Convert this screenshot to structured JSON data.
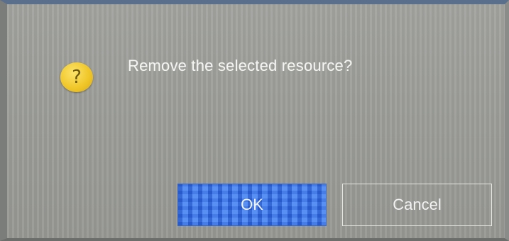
{
  "dialog": {
    "message": "Remove the selected resource?",
    "icon": "question-icon",
    "icon_glyph": "?",
    "buttons": {
      "ok_label": "OK",
      "cancel_label": "Cancel"
    }
  }
}
